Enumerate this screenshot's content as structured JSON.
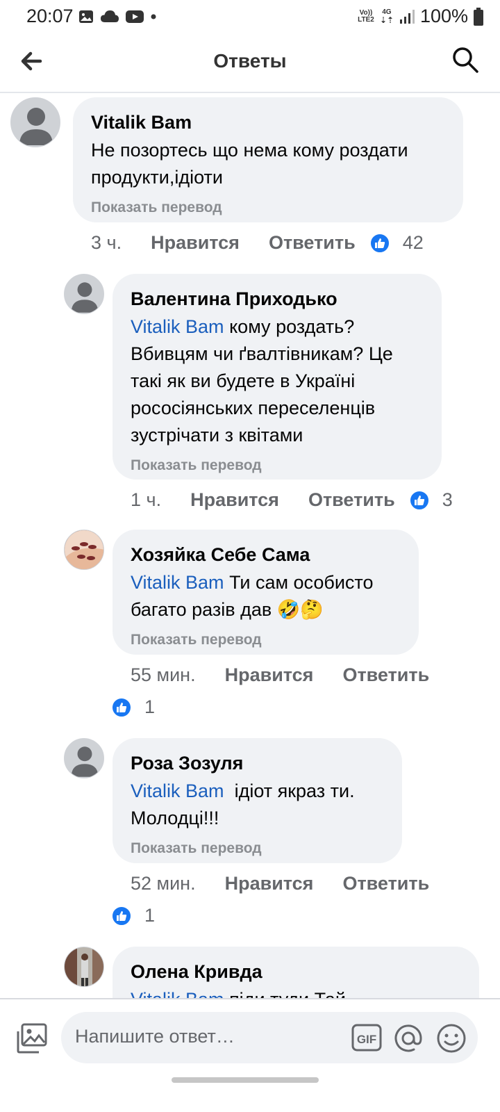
{
  "status_bar": {
    "time": "20:07",
    "battery": "100%",
    "volte": "Vo))",
    "lte": "LTE2",
    "network": "4G",
    "icons": [
      "image-icon",
      "cloud-icon",
      "youtube-icon",
      "dot-icon",
      "signal-icon",
      "battery-icon"
    ]
  },
  "header": {
    "title": "Ответы",
    "back_icon": "arrow-left-icon",
    "search_icon": "search-icon"
  },
  "comments": [
    {
      "author": "Vitalik Bam",
      "mention": "",
      "text": "Не позортесь що нема кому роздати продукти,ідіоти",
      "translate": "Показать перевод",
      "time": "3 ч.",
      "like_label": "Нравится",
      "reply_label": "Ответить",
      "likes": "42",
      "avatar": "default-avatar-icon"
    },
    {
      "author": "Валентина Приходько",
      "mention": "Vitalik Bam",
      "text": " кому роздать? Вбивцям чи ґвалтівникам? Це такі як ви будете в Україні рососіянських переселенців зустрічати з квітами",
      "translate": "Показать перевод",
      "time": "1 ч.",
      "like_label": "Нравится",
      "reply_label": "Ответить",
      "likes": "3",
      "avatar": "default-avatar-icon"
    },
    {
      "author": "Хозяйка Себе Сама",
      "mention": "Vitalik Bam",
      "text": " Ти сам особисто багато разів дав 🤣🤔",
      "translate": "Показать перевод",
      "time": "55 мин.",
      "like_label": "Нравится",
      "reply_label": "Ответить",
      "likes": "1",
      "avatar": "photo-avatar-hands"
    },
    {
      "author": "Роза Зозуля",
      "mention": "Vitalik Bam",
      "text": "  ідіот якраз ти. Молодці!!!",
      "translate": "Показать перевод",
      "time": "52 мин.",
      "like_label": "Нравится",
      "reply_label": "Ответить",
      "likes": "1",
      "avatar": "default-avatar-icon"
    },
    {
      "author": "Олена Кривда",
      "mention": "Vitalik Bam",
      "text": " піди туди Тай",
      "avatar": "photo-avatar-street"
    }
  ],
  "composer": {
    "placeholder": "Напишите ответ…",
    "gif_label": "GIF",
    "icons": [
      "photo-icon",
      "gif-icon",
      "at-icon",
      "emoji-icon"
    ]
  }
}
